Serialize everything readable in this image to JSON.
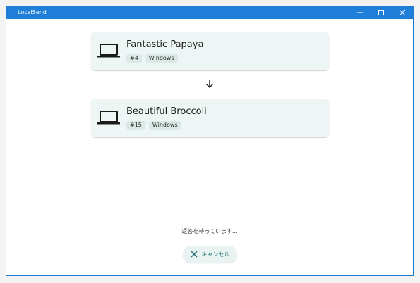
{
  "window": {
    "title": "LocalSend"
  },
  "devices": {
    "sender": {
      "name": "Fantastic Papaya",
      "id_tag": "#4",
      "os_tag": "Windows",
      "icon": "laptop-icon"
    },
    "receiver": {
      "name": "Beautiful Broccoli",
      "id_tag": "#15",
      "os_tag": "Windows",
      "icon": "laptop-icon"
    }
  },
  "status": {
    "text": "返答を待っています..."
  },
  "actions": {
    "cancel_label": "キャンセル",
    "cancel_icon": "close-icon"
  },
  "colors": {
    "titlebar": "#1f7fd8",
    "card_bg": "#eef6f5",
    "accent": "#1b6f6b"
  }
}
